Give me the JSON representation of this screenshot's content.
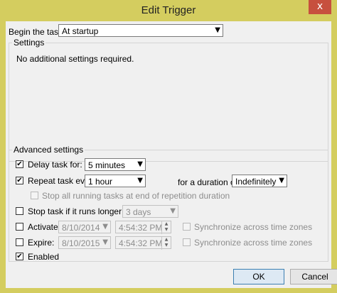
{
  "window": {
    "title": "Edit Trigger",
    "close_glyph": "x"
  },
  "begin_task": {
    "label": "Begin the task:",
    "value": "At startup"
  },
  "settings": {
    "title": "Settings",
    "message": "No additional settings required."
  },
  "advanced": {
    "title": "Advanced settings",
    "delay_task": {
      "label": "Delay task for:",
      "checked": true,
      "value": "5 minutes"
    },
    "repeat_task": {
      "label": "Repeat task every:",
      "checked": true,
      "value": "1 hour",
      "duration_label": "for a duration of:",
      "duration_value": "Indefinitely"
    },
    "stop_repetition": {
      "label": "Stop all running tasks at end of repetition duration",
      "checked": false
    },
    "stop_longer": {
      "label": "Stop task if it runs longer than:",
      "checked": false,
      "value": "3 days"
    },
    "activate": {
      "label": "Activate:",
      "checked": false,
      "date": "8/10/2014",
      "time": "4:54:32 PM",
      "sync_label": "Synchronize across time zones"
    },
    "expire": {
      "label": "Expire:",
      "checked": false,
      "date": "8/10/2015",
      "time": "4:54:32 PM",
      "sync_label": "Synchronize across time zones"
    },
    "enabled": {
      "label": "Enabled",
      "checked": true
    }
  },
  "buttons": {
    "ok": "OK",
    "cancel": "Cancel"
  },
  "icons": {
    "check": "✔",
    "dropdown": "▼",
    "spin_up": "▲",
    "spin_down": "▼",
    "calendar": "calendar-icon"
  }
}
